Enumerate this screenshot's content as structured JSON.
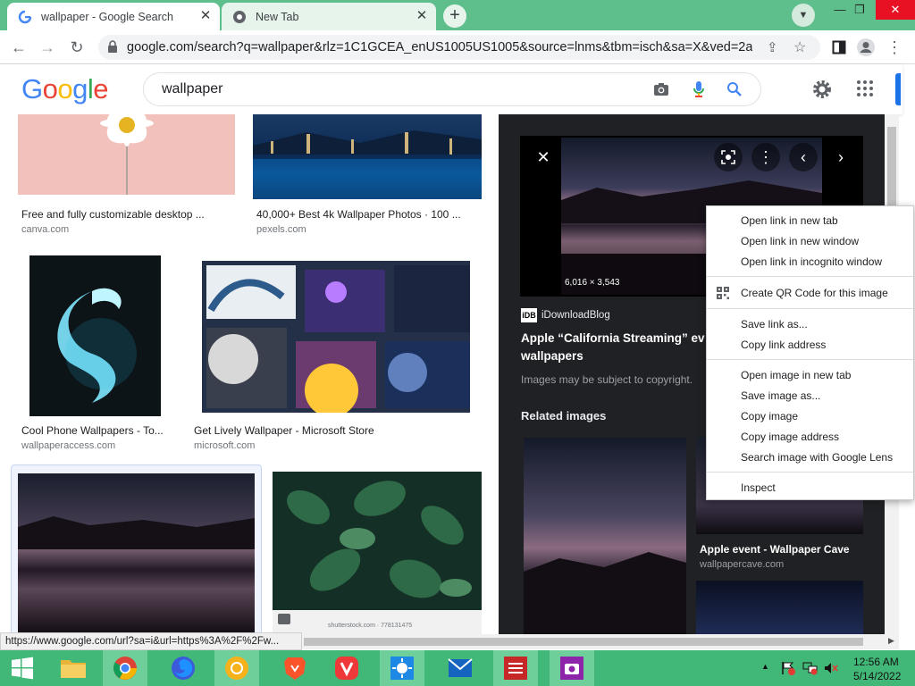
{
  "tabs": [
    {
      "title": "wallpaper - Google Search",
      "favicon": "G"
    },
    {
      "title": "New Tab"
    }
  ],
  "address": {
    "url": "google.com/search?q=wallpaper&rlz=1C1GCEA_enUS1005US1005&source=lnms&tbm=isch&sa=X&ved=2ahU..."
  },
  "google": {
    "logo": "Google",
    "query": "wallpaper",
    "colors": {
      "blue": "#4285f4",
      "red": "#ea4335",
      "yellow": "#fbbc05",
      "green": "#34a853"
    }
  },
  "results": [
    {
      "caption": "Free and fully customizable desktop ...",
      "source": "canva.com"
    },
    {
      "caption": "40,000+ Best 4k Wallpaper Photos · 100 ...",
      "source": "pexels.com"
    },
    {
      "caption": "Cool Phone Wallpapers - To...",
      "source": "wallpaperaccess.com"
    },
    {
      "caption": "Get Lively Wallpaper - Microsoft Store",
      "source": "microsoft.com"
    },
    {
      "caption": "",
      "source": ""
    },
    {
      "caption": "",
      "source": "shutterstock.com · 778131475"
    }
  ],
  "panel": {
    "dimensions": "6,016 × 3,543",
    "site_badge": "iDB",
    "site": "iDownloadBlog",
    "title_line1": "Apple “California Streaming” ev",
    "title_line2": "wallpapers",
    "copyright": "Images may be subject to copyright.",
    "related_heading": "Related images",
    "related_caption": "Apple event - Wallpaper Cave",
    "related_source": "wallpapercave.com"
  },
  "context_menu": {
    "group1": [
      "Open link in new tab",
      "Open link in new window",
      "Open link in incognito window"
    ],
    "qr": "Create QR Code for this image",
    "group2": [
      "Save link as...",
      "Copy link address"
    ],
    "group3": [
      "Open image in new tab",
      "Save image as...",
      "Copy image",
      "Copy image address",
      "Search image with Google Lens"
    ],
    "inspect": "Inspect"
  },
  "status_url": "https://www.google.com/url?sa=i&url=https%3A%2F%2Fw...",
  "taskbar": {
    "time": "12:56 AM",
    "date": "5/14/2022"
  }
}
